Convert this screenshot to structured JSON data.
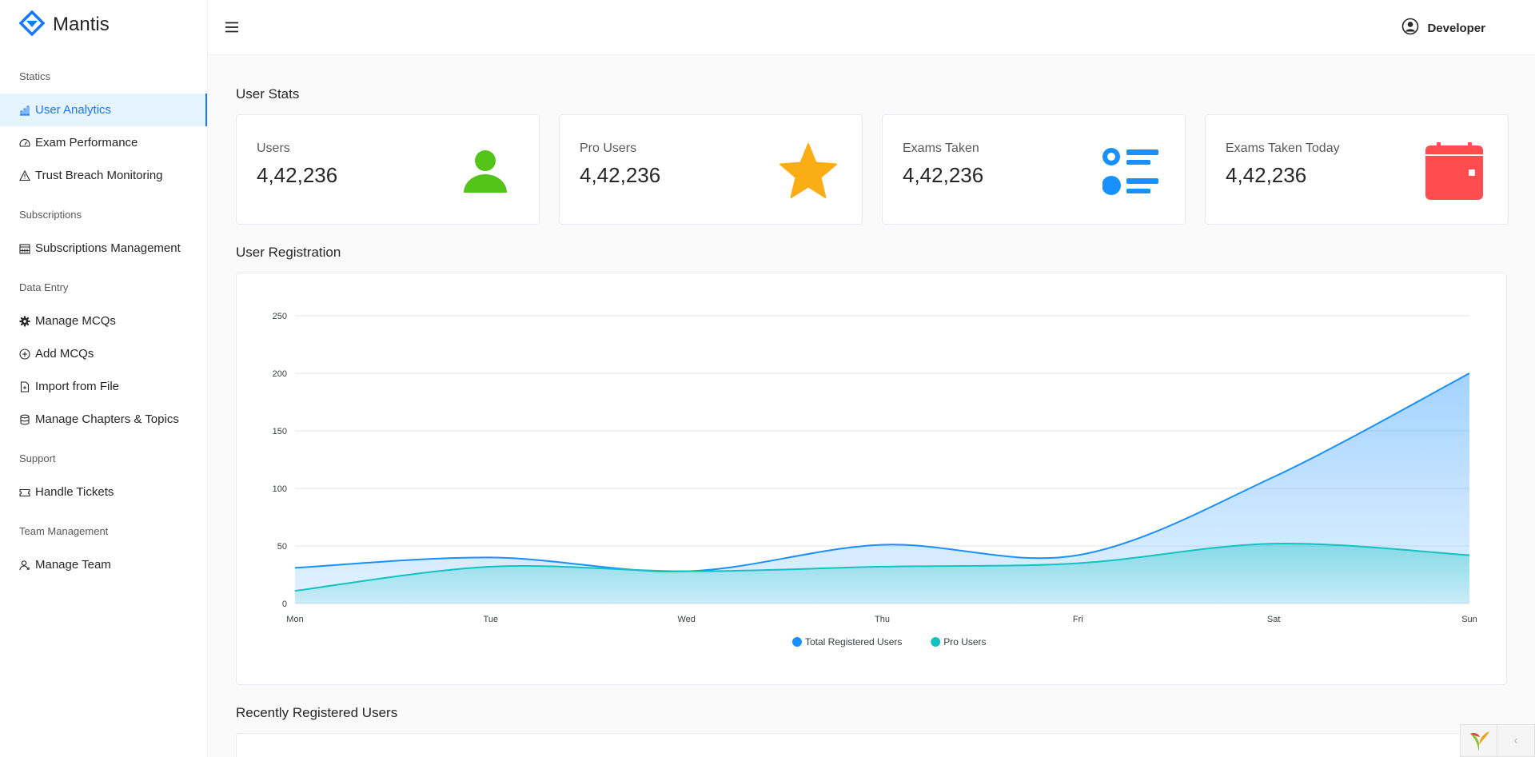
{
  "brand": {
    "name": "Mantis",
    "logo_icon": "mantis-diamond-logo",
    "color": "#1677ff"
  },
  "sidebar": {
    "groups": [
      {
        "title": "Statics",
        "items": [
          {
            "label": "User Analytics",
            "icon": "bar-chart-icon",
            "active": true
          },
          {
            "label": "Exam Performance",
            "icon": "dashboard-gauge-icon"
          },
          {
            "label": "Trust Breach Monitoring",
            "icon": "warning-icon"
          }
        ]
      },
      {
        "title": "Subscriptions",
        "items": [
          {
            "label": "Subscriptions Management",
            "icon": "calendar-grid-icon"
          }
        ]
      },
      {
        "title": "Data Entry",
        "items": [
          {
            "label": "Manage MCQs",
            "icon": "gear-icon"
          },
          {
            "label": "Add MCQs",
            "icon": "plus-circle-icon"
          },
          {
            "label": "Import from File",
            "icon": "file-add-icon"
          },
          {
            "label": "Manage Chapters & Topics",
            "icon": "database-icon"
          }
        ]
      },
      {
        "title": "Support",
        "items": [
          {
            "label": "Handle Tickets",
            "icon": "ticket-icon"
          }
        ]
      },
      {
        "title": "Team Management",
        "items": [
          {
            "label": "Manage Team",
            "icon": "team-user-icon"
          }
        ]
      }
    ]
  },
  "header": {
    "menu_icon": "hamburger-menu-icon",
    "user_name": "Developer",
    "user_icon": "user-circle-icon"
  },
  "main": {
    "stats_title": "User Stats",
    "stats": [
      {
        "label": "Users",
        "value": "4,42,236",
        "icon": "user-icon",
        "color": "#52c41a"
      },
      {
        "label": "Pro Users",
        "value": "4,42,236",
        "icon": "star-icon",
        "color": "#faad14"
      },
      {
        "label": "Exams Taken",
        "value": "4,42,236",
        "icon": "list-icon",
        "color": "#1890ff"
      },
      {
        "label": "Exams Taken Today",
        "value": "4,42,236",
        "icon": "calendar-icon",
        "color": "#ff4d4f"
      }
    ],
    "registration_title": "User Registration",
    "recent_title": "Recently Registered Users"
  },
  "chart_data": {
    "type": "area",
    "title": "User Registration",
    "categories": [
      "Mon",
      "Tue",
      "Wed",
      "Thu",
      "Fri",
      "Sat",
      "Sun"
    ],
    "ylim": [
      0,
      250
    ],
    "yticks": [
      0,
      50,
      100,
      150,
      200,
      250
    ],
    "grid": true,
    "legend": "bottom-center",
    "series": [
      {
        "name": "Total Registered Users",
        "values": [
          31,
          40,
          28,
          51,
          42,
          110,
          200
        ],
        "color": "#1890ff"
      },
      {
        "name": "Pro Users",
        "values": [
          11,
          32,
          28,
          32,
          35,
          52,
          42
        ],
        "color": "#13c2c2"
      }
    ]
  }
}
